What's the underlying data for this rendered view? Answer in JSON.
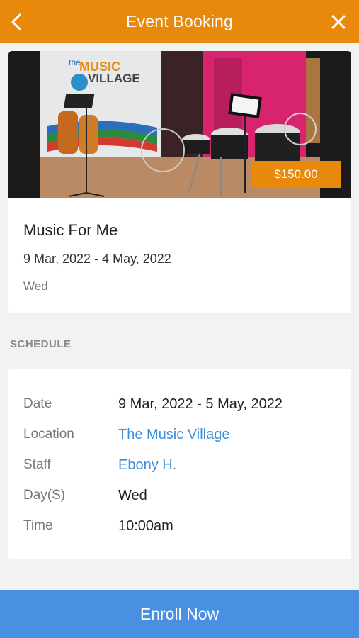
{
  "header": {
    "title": "Event Booking",
    "back_icon": "chevron-left-icon",
    "close_icon": "close-icon"
  },
  "event": {
    "banner_logo_line1": "the",
    "banner_logo_line2": "MUSIC",
    "banner_logo_line3": "VILLAGE",
    "price": "$150.00",
    "title": "Music For Me",
    "dates": "9 Mar, 2022 - 4 May, 2022",
    "day": "Wed"
  },
  "schedule": {
    "section_label": "SCHEDULE",
    "rows": [
      {
        "label": "Date",
        "value": "9 Mar, 2022 - 5 May, 2022"
      },
      {
        "label": "Location",
        "value": "The Music Village"
      },
      {
        "label": "Staff",
        "value": "Ebony H."
      },
      {
        "label": "Day(S)",
        "value": "Wed"
      },
      {
        "label": "Time",
        "value": "10:00am"
      }
    ]
  },
  "footer": {
    "enroll_label": "Enroll Now"
  },
  "colors": {
    "accent": "#e8890c",
    "link": "#3d8fd9",
    "button": "#4a90e2"
  }
}
